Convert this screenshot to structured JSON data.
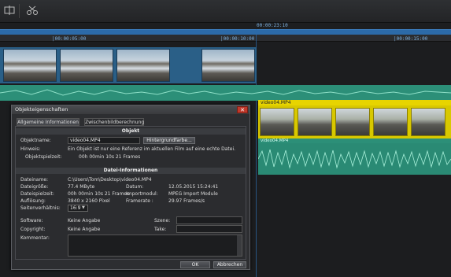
{
  "timeline": {
    "playhead_tc": "00:00:23:10",
    "ruler_labels": [
      "|00:00:05:00",
      "|00:00:10:00",
      "|00:00:15:00"
    ],
    "clip_label": "video04.MP4",
    "audio_label": "video04.MP4"
  },
  "dialog": {
    "title": "Objekteigenschaften",
    "close_label": "✕",
    "tabs": [
      "Allgemeine Informationen",
      "Zwischenbildberechnung"
    ],
    "object_section": "Objekt",
    "object_name_label": "Objektname:",
    "object_name_value": "video04.MP4",
    "background_button": "Hintergrundfarbe...",
    "hint_label": "Hinweis:",
    "hint_text": "Ein Objekt ist nur eine Referenz im aktuellen Film auf eine echte Datei.",
    "object_duration_label": "Objektspielzeit:",
    "object_duration_value": "00h 00min 10s 21 Frames",
    "file_section": "Datei-Informationen",
    "filename_label": "Dateiname:",
    "filename_value": "C:\\Users\\Tom\\Desktop\\video04.MP4",
    "filesize_label": "Dateigröße:",
    "filesize_value": "77.4 MByte",
    "date_label": "Datum:",
    "date_value": "12.05.2015 15:24:41",
    "file_duration_label": "Dateispielzeit:",
    "file_duration_value": "00h 00min 10s 21 Frames",
    "import_label": "Importmodul:",
    "import_value": "MPEG Import Module",
    "resolution_label": "Auflösung:",
    "resolution_value": "3840 x 2160 Pixel",
    "framerate_label": "Framerate :",
    "framerate_value": "29.97 Frames/s",
    "aspect_label": "Seitenverhältnis:",
    "aspect_value": "16:9",
    "software_label": "Software:",
    "software_value": "Keine Angabe",
    "scene_label": "Szene:",
    "copyright_label": "Copyright:",
    "copyright_value": "Keine Angabe",
    "take_label": "Take:",
    "comment_label": "Kommentar:",
    "ok_button": "OK",
    "cancel_button": "Abbrechen"
  },
  "colors": {
    "accent_blue": "#2c6aa8",
    "clip_yellow": "#e7d400",
    "audio_green": "#2c8f78"
  }
}
